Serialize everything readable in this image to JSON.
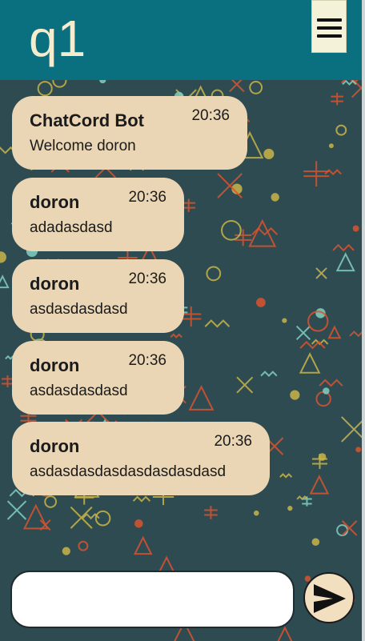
{
  "header": {
    "room_name": "q1",
    "menu_icon": "hamburger-menu-icon"
  },
  "messages": [
    {
      "username": "ChatCord Bot",
      "time": "20:36",
      "text": "Welcome doron"
    },
    {
      "username": "doron",
      "time": "20:36",
      "text": "adadasdasd"
    },
    {
      "username": "doron",
      "time": "20:36",
      "text": "asdasdasdasd"
    },
    {
      "username": "doron",
      "time": "20:36",
      "text": "asdasdasdasd"
    },
    {
      "username": "doron",
      "time": "20:36",
      "text": "asdasdasdasdasdasdasdasd"
    }
  ],
  "composer": {
    "input_value": "",
    "placeholder": "",
    "send_icon": "send-arrow-icon"
  },
  "colors": {
    "header": "#0a6f7e",
    "title": "#f3eccf",
    "bubble": "#ead6b4",
    "background": "#2e4b52",
    "pattern_red": "#d9532f",
    "pattern_yellow": "#c9b548",
    "pattern_teal": "#7fd0c0"
  }
}
